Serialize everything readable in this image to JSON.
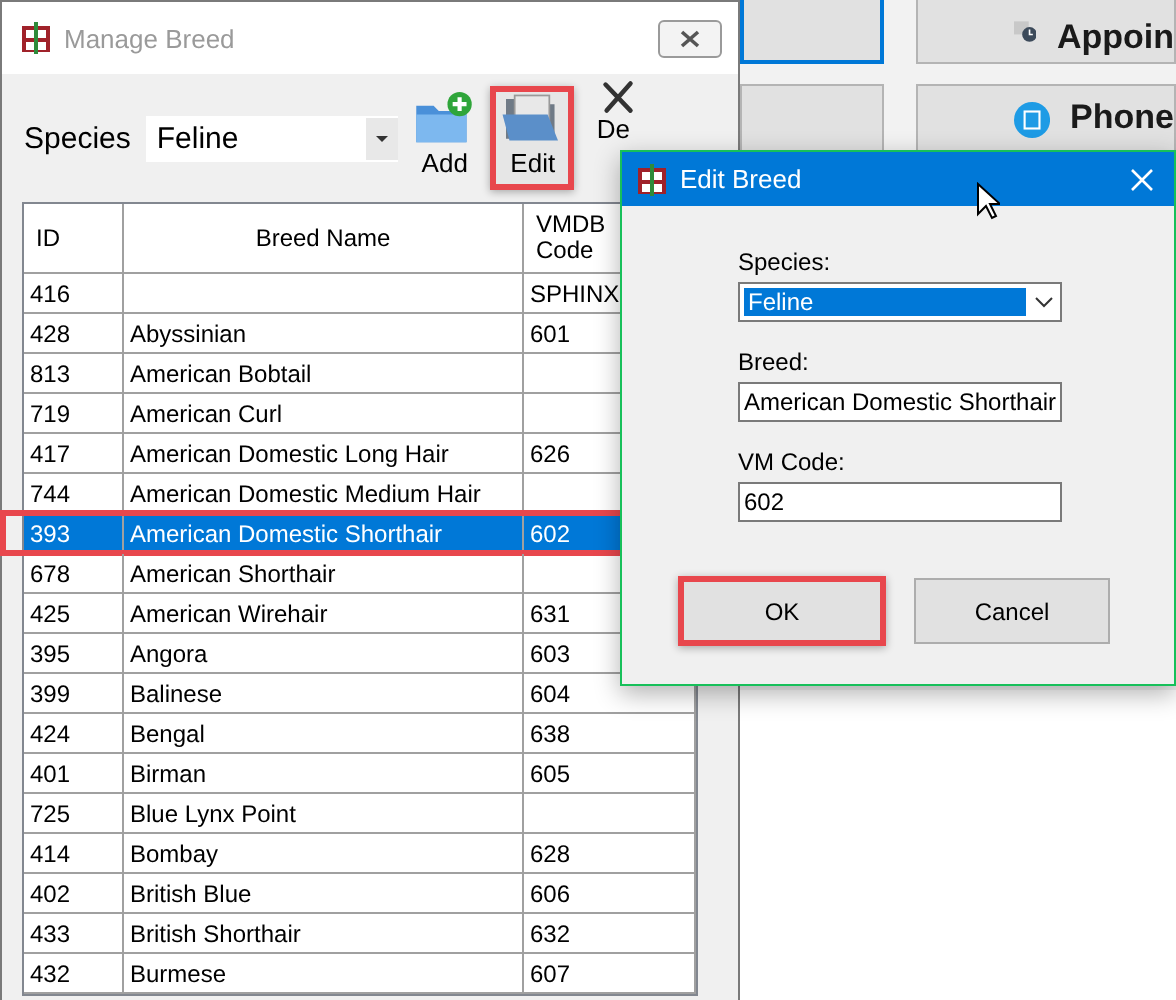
{
  "background_app": {
    "tiles": [
      {
        "kind": "blank",
        "focused": true
      },
      {
        "kind": "appointment",
        "label": "Appoin",
        "focused": false
      },
      {
        "kind": "blank",
        "focused": false
      },
      {
        "kind": "phone",
        "label": "Phone",
        "focused": false
      }
    ]
  },
  "manage_window": {
    "title": "Manage Breed",
    "species": {
      "label": "Species",
      "value": "Feline"
    },
    "toolbar": [
      {
        "kind": "add",
        "label": "Add",
        "highlighted": false
      },
      {
        "kind": "edit",
        "label": "Edit",
        "highlighted": true
      },
      {
        "kind": "delete",
        "label": "De",
        "highlighted": false
      }
    ],
    "table": {
      "columns": [
        "ID",
        "Breed Name",
        "VMDB Code"
      ],
      "rows": [
        {
          "id": "416",
          "code": "SPHINX",
          "selected": false,
          "highlighted": false
        },
        {
          "id": "428",
          "name": "Abyssinian",
          "code": "601",
          "selected": false,
          "highlighted": false
        },
        {
          "id": "813",
          "name": "American Bobtail",
          "selected": false,
          "highlighted": false
        },
        {
          "id": "719",
          "name": "American Curl",
          "selected": false,
          "highlighted": false
        },
        {
          "id": "417",
          "name": "American Domestic Long Hair",
          "code": "626",
          "selected": false,
          "highlighted": false
        },
        {
          "id": "744",
          "name": "American Domestic Medium Hair",
          "selected": false,
          "highlighted": false
        },
        {
          "id": "393",
          "name": "American Domestic Shorthair",
          "code": "602",
          "selected": true,
          "highlighted": true
        },
        {
          "id": "678",
          "name": "American Shorthair",
          "selected": false,
          "highlighted": false
        },
        {
          "id": "425",
          "name": "American Wirehair",
          "code": "631",
          "selected": false,
          "highlighted": false
        },
        {
          "id": "395",
          "name": "Angora",
          "code": "603",
          "selected": false,
          "highlighted": false
        },
        {
          "id": "399",
          "name": "Balinese",
          "code": "604",
          "selected": false,
          "highlighted": false
        },
        {
          "id": "424",
          "name": "Bengal",
          "code": "638",
          "selected": false,
          "highlighted": false
        },
        {
          "id": "401",
          "name": "Birman",
          "code": "605",
          "selected": false,
          "highlighted": false
        },
        {
          "id": "725",
          "name": "Blue Lynx Point",
          "selected": false,
          "highlighted": false
        },
        {
          "id": "414",
          "name": "Bombay",
          "code": "628",
          "selected": false,
          "highlighted": false
        },
        {
          "id": "402",
          "name": "British Blue",
          "code": "606",
          "selected": false,
          "highlighted": false
        },
        {
          "id": "433",
          "name": "British Shorthair",
          "code": "632",
          "selected": false,
          "highlighted": false
        },
        {
          "id": "432",
          "name": "Burmese",
          "code": "607",
          "selected": false,
          "highlighted": false
        }
      ]
    }
  },
  "edit_dialog": {
    "title": "Edit Breed",
    "fields": [
      {
        "kind": "select",
        "label": "Species:",
        "value": "Feline"
      },
      {
        "kind": "text",
        "label": "Breed:",
        "value": "American Domestic Shorthair"
      },
      {
        "kind": "text",
        "label": "VM Code:",
        "value": "602"
      }
    ],
    "buttons": [
      {
        "label": "OK",
        "highlighted": true
      },
      {
        "label": "Cancel",
        "highlighted": false
      }
    ]
  }
}
